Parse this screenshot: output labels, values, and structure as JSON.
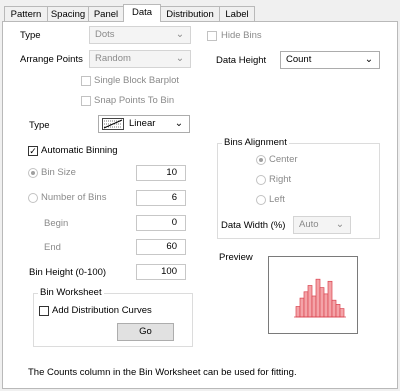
{
  "tabs": [
    "Pattern",
    "Spacing",
    "Panel",
    "Data",
    "Distribution",
    "Label"
  ],
  "active_tab": "Data",
  "left": {
    "type_label": "Type",
    "type_value": "Dots",
    "arrange_label": "Arrange Points",
    "arrange_value": "Random",
    "single_block_label": "Single Block Barplot",
    "snap_points_label": "Snap Points To Bin"
  },
  "right": {
    "hide_bins_label": "Hide Bins",
    "data_height_label": "Data Height",
    "data_height_value": "Count"
  },
  "scale": {
    "type_label": "Type",
    "value": "Linear"
  },
  "binning": {
    "automatic_label": "Automatic Binning",
    "automatic_checked": true,
    "bin_size_label": "Bin Size",
    "bin_size_value": "10",
    "num_bins_label": "Number of Bins",
    "num_bins_value": "6",
    "begin_label": "Begin",
    "begin_value": "0",
    "end_label": "End",
    "end_value": "60",
    "bin_height_label": "Bin Height (0-100)",
    "bin_height_value": "100"
  },
  "worksheet": {
    "title": "Bin Worksheet",
    "add_curves_label": "Add Distribution Curves",
    "go_label": "Go"
  },
  "alignment": {
    "title": "Bins Alignment",
    "center_label": "Center",
    "right_label": "Right",
    "left_label": "Left",
    "data_width_label": "Data Width (%)",
    "data_width_value": "Auto"
  },
  "preview": {
    "label": "Preview",
    "bar_heights": [
      0.25,
      0.45,
      0.6,
      0.75,
      0.5,
      0.9,
      0.7,
      0.55,
      0.85,
      0.4,
      0.3,
      0.2
    ],
    "bar_color": "#f4a3a8",
    "bar_border": "#d9434f"
  },
  "footer": "The Counts column in the Bin Worksheet can be used for fitting."
}
